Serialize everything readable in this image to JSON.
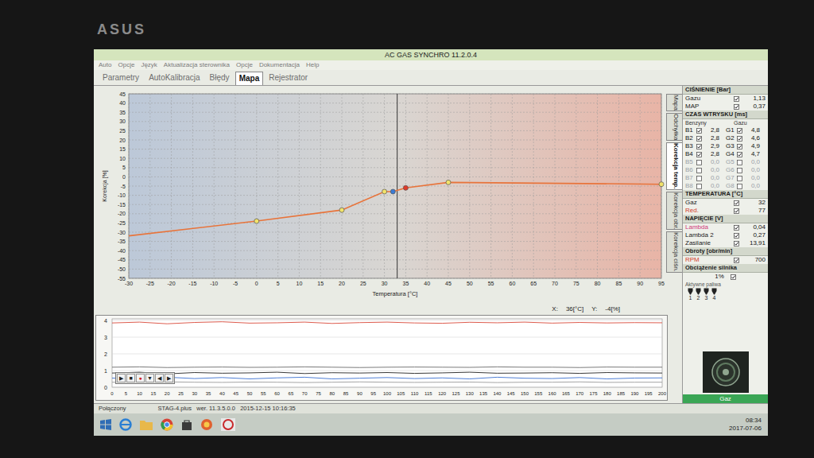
{
  "bezel": {
    "logo": "ASUS"
  },
  "window": {
    "title": "AC GAS SYNCHRO  11.2.0.4"
  },
  "menu": [
    "Auto",
    "Opcje",
    "Język",
    "Aktualizacja sterownika",
    "Opcje",
    "Dokumentacja",
    "Help"
  ],
  "tabs": [
    {
      "label": "Parametry",
      "selected": false
    },
    {
      "label": "AutoKalibracja",
      "selected": false
    },
    {
      "label": "Błędy",
      "selected": false
    },
    {
      "label": "Mapa",
      "selected": true
    },
    {
      "label": "Rejestrator",
      "selected": false
    }
  ],
  "map_chart": {
    "y_title": "Korekcja [%]",
    "x_title": "Temperatura [°C]",
    "x_ticks": [
      "-30",
      "-25",
      "-20",
      "-15",
      "-10",
      "-5",
      "0",
      "5",
      "10",
      "15",
      "20",
      "25",
      "30",
      "35",
      "40",
      "45",
      "50",
      "55",
      "60",
      "65",
      "70",
      "75",
      "80",
      "85",
      "90",
      "95"
    ],
    "y_ticks": [
      "45",
      "40",
      "35",
      "30",
      "25",
      "20",
      "15",
      "10",
      "5",
      "0",
      "-5",
      "-10",
      "-15",
      "-20",
      "-25",
      "-30",
      "-35",
      "-40",
      "-45",
      "-50",
      "-55"
    ],
    "cursor_x": 33,
    "points": [
      {
        "x": -30,
        "y": -32,
        "marked": false,
        "color": "#e8743b"
      },
      {
        "x": 0,
        "y": -24,
        "marked": true,
        "color": "#f2e36b"
      },
      {
        "x": 20,
        "y": -18,
        "marked": true,
        "color": "#f2e36b"
      },
      {
        "x": 30,
        "y": -8,
        "marked": true,
        "color": "#f2e36b"
      },
      {
        "x": 32,
        "y": -8,
        "marked": true,
        "color": "#3a7bd5"
      },
      {
        "x": 35,
        "y": -6,
        "marked": true,
        "color": "#e03a2a"
      },
      {
        "x": 45,
        "y": -3,
        "marked": true,
        "color": "#f2e36b"
      },
      {
        "x": 95,
        "y": -4,
        "marked": true,
        "color": "#f2e36b"
      }
    ]
  },
  "readout": {
    "x_label": "X:",
    "x_value": "36[°C]",
    "y_label": "Y:",
    "y_value": "-4[%]"
  },
  "vertical_tabs": [
    {
      "label": "Mapa",
      "selected": false
    },
    {
      "label": "Odchyłka",
      "selected": false
    },
    {
      "label": "Korekcja temp.",
      "selected": true
    },
    {
      "label": "Korekcja obr.",
      "selected": false
    },
    {
      "label": "Korekcja ciśn.",
      "selected": false
    }
  ],
  "right_panel": {
    "pressure": {
      "title": "CIŚNIENIE [Bar]",
      "rows": [
        {
          "label": "Gazu",
          "checked": true,
          "value": "1,13",
          "color": "#1a1a1a"
        },
        {
          "label": "MAP",
          "checked": true,
          "value": "0,37",
          "color": "#1a1a1a"
        }
      ]
    },
    "injection": {
      "title": "CZAS WTRYSKU [ms]",
      "headers": [
        "Benzyny",
        "Gazu"
      ],
      "rows": [
        {
          "b": "B1",
          "b_value": "2,8",
          "g": "G1",
          "g_value": "4,8",
          "active": true
        },
        {
          "b": "B2",
          "b_value": "2,8",
          "g": "G2",
          "g_value": "4,6",
          "active": true
        },
        {
          "b": "B3",
          "b_value": "2,9",
          "g": "G3",
          "g_value": "4,9",
          "active": true
        },
        {
          "b": "B4",
          "b_value": "2,8",
          "g": "G4",
          "g_value": "4,7",
          "active": true
        },
        {
          "b": "B5",
          "b_value": "0,0",
          "g": "G5",
          "g_value": "0,0",
          "active": false
        },
        {
          "b": "B6",
          "b_value": "0,0",
          "g": "G6",
          "g_value": "0,0",
          "active": false
        },
        {
          "b": "B7",
          "b_value": "0,0",
          "g": "G7",
          "g_value": "0,0",
          "active": false
        },
        {
          "b": "B8",
          "b_value": "0,0",
          "g": "G8",
          "g_value": "0,0",
          "active": false
        }
      ]
    },
    "temperature": {
      "title": "TEMPERATURA [°C]",
      "rows": [
        {
          "label": "Gaz",
          "checked": true,
          "value": "32",
          "color": "#1a1a1a"
        },
        {
          "label": "Red.",
          "checked": true,
          "value": "77",
          "color": "#d23a2a"
        }
      ]
    },
    "voltage": {
      "title": "NAPIĘCIE [V]",
      "rows": [
        {
          "label": "Lambda",
          "checked": true,
          "value": "0,04",
          "color": "#d23a7a"
        },
        {
          "label": "Lambda 2",
          "checked": true,
          "value": "0,27",
          "color": "#1a1a1a"
        },
        {
          "label": "Zasilanie",
          "checked": true,
          "value": "13,91",
          "color": "#1a1a1a"
        }
      ]
    },
    "rpm": {
      "title": "Obroty [obr/min]",
      "rows": [
        {
          "label": "RPM",
          "checked": true,
          "value": "700",
          "color": "#d23a2a"
        }
      ]
    },
    "load": {
      "title": "Obciążenie silnika",
      "value": "1%",
      "checked": true
    },
    "injectors": {
      "title": "Aktywne paliwa",
      "items": [
        {
          "label": "1",
          "active": true
        },
        {
          "label": "2",
          "active": true
        },
        {
          "label": "3",
          "active": true
        },
        {
          "label": "4",
          "active": true
        }
      ]
    },
    "fuel": "Gaz"
  },
  "recorder": {
    "x_ticks": [
      "0",
      "5",
      "10",
      "15",
      "20",
      "25",
      "30",
      "35",
      "40",
      "45",
      "50",
      "55",
      "60",
      "65",
      "70",
      "75",
      "80",
      "85",
      "90",
      "95",
      "100",
      "105",
      "110",
      "115",
      "120",
      "125",
      "130",
      "135",
      "140",
      "145",
      "150",
      "155",
      "160",
      "165",
      "170",
      "175",
      "180",
      "185",
      "190",
      "195",
      "200"
    ],
    "y_ticks": [
      "0",
      "1",
      "2",
      "3",
      "4"
    ],
    "series": [
      {
        "color": "#d94a3a",
        "values": [
          3.85,
          3.9,
          3.8,
          3.88,
          3.92,
          3.84,
          3.86,
          3.9,
          3.82,
          3.87,
          3.9,
          3.85,
          3.83,
          3.89,
          3.86,
          3.9,
          3.84,
          3.88,
          3.85,
          3.87,
          3.86
        ]
      },
      {
        "color": "#6b6b6b",
        "values": [
          1.2,
          1.22,
          1.18,
          1.2,
          1.21,
          1.19,
          1.2,
          1.22,
          1.2,
          1.18,
          1.2,
          1.21,
          1.2,
          1.19,
          1.22,
          1.2,
          1.2,
          1.18,
          1.21,
          1.2,
          1.2
        ]
      },
      {
        "color": "#222222",
        "values": [
          0.85,
          0.9,
          0.8,
          0.88,
          0.84,
          0.86,
          0.9,
          0.82,
          0.87,
          0.85,
          0.88,
          0.83,
          0.86,
          0.9,
          0.84,
          0.85,
          0.87,
          0.83,
          0.88,
          0.86,
          0.85
        ]
      },
      {
        "color": "#3a6fd0",
        "values": [
          0.55,
          0.5,
          0.6,
          0.52,
          0.58,
          0.5,
          0.56,
          0.6,
          0.5,
          0.54,
          0.58,
          0.52,
          0.56,
          0.5,
          0.6,
          0.54,
          0.52,
          0.58,
          0.5,
          0.55,
          0.56
        ]
      },
      {
        "color": "#9a9a9a",
        "values": [
          0.3,
          0.28,
          0.32,
          0.3,
          0.29,
          0.31,
          0.3,
          0.28,
          0.3,
          0.32,
          0.3,
          0.29,
          0.3,
          0.31,
          0.28,
          0.3,
          0.3,
          0.32,
          0.29,
          0.3,
          0.3
        ]
      }
    ],
    "controls": [
      "▶",
      "■",
      "●",
      "▼",
      "◀",
      "▶"
    ]
  },
  "status_bar": {
    "connection": "Połączony",
    "device": "STAG-4.plus   wer. 11.3.5.0.0   2015-12-15 10:16:35"
  },
  "taskbar": {
    "time": "08:34",
    "date": "2017-07-06"
  }
}
